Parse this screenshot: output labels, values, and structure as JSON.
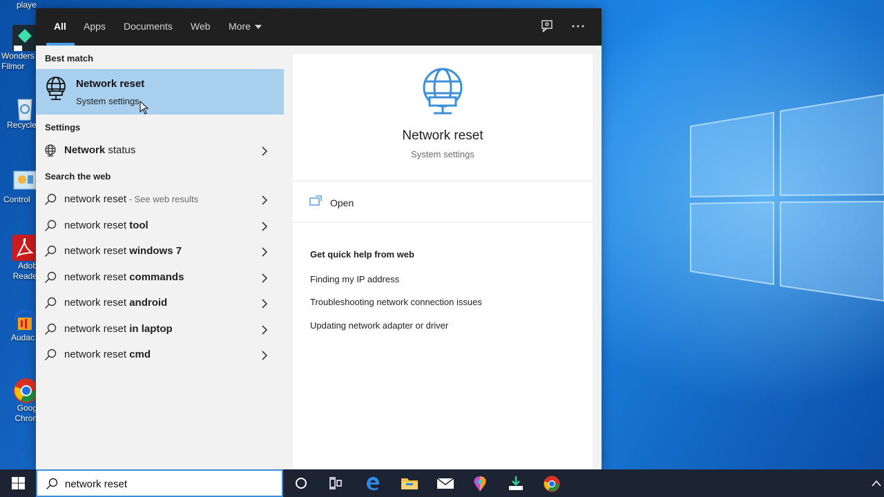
{
  "desktop": {
    "icons": [
      {
        "label": "player",
        "icon": "media-player-icon"
      },
      {
        "label": "Wonders Filmor",
        "icon": "filmora-app-icon"
      },
      {
        "label": "Recycle",
        "icon": "recycle-bin-icon"
      },
      {
        "label": "Control",
        "icon": "control-panel-icon"
      },
      {
        "label": "Adob Reade",
        "icon": "adobe-reader-icon"
      },
      {
        "label": "Audac",
        "icon": "audacity-icon"
      },
      {
        "label": "Goog Chron",
        "icon": "google-chrome-icon"
      }
    ]
  },
  "search_panel": {
    "tabs": [
      {
        "label": "All",
        "active": true
      },
      {
        "label": "Apps",
        "active": false
      },
      {
        "label": "Documents",
        "active": false
      },
      {
        "label": "Web",
        "active": false
      },
      {
        "label": "More",
        "active": false
      }
    ],
    "header_icons": [
      "feedback-icon",
      "more-options-icon"
    ],
    "best_match": {
      "heading": "Best match",
      "title": "Network reset",
      "subtitle": "System settings",
      "icon": "globe-monitor-icon"
    },
    "settings": {
      "heading": "Settings",
      "items": [
        {
          "bold": "Network",
          "rest": " status",
          "icon": "globe-icon"
        }
      ]
    },
    "web": {
      "heading": "Search the web",
      "items": [
        {
          "plain": "network reset",
          "bold": "",
          "suffix": " - See web results"
        },
        {
          "plain": "network reset ",
          "bold": "tool",
          "suffix": ""
        },
        {
          "plain": "network reset ",
          "bold": "windows 7",
          "suffix": ""
        },
        {
          "plain": "network reset ",
          "bold": "commands",
          "suffix": ""
        },
        {
          "plain": "network reset ",
          "bold": "android",
          "suffix": ""
        },
        {
          "plain": "network reset ",
          "bold": "in laptop",
          "suffix": ""
        },
        {
          "plain": "network reset ",
          "bold": "cmd",
          "suffix": ""
        }
      ]
    },
    "preview": {
      "title": "Network reset",
      "subtitle": "System settings",
      "open_label": "Open",
      "quick_help_heading": "Get quick help from web",
      "links": [
        "Finding my IP address",
        "Troubleshooting network connection issues",
        "Updating network adapter or driver"
      ]
    }
  },
  "taskbar": {
    "search_value": "network reset",
    "buttons": [
      "cortana-icon",
      "task-view-icon",
      "edge-icon",
      "file-explorer-icon",
      "mail-icon",
      "paint-3d-icon",
      "installer-icon",
      "chrome-icon"
    ]
  },
  "colors": {
    "accent": "#4aa0e6",
    "best_match_bg": "#a9cfee",
    "header_bg": "#202020",
    "taskbar_bg": "#1c2433"
  }
}
